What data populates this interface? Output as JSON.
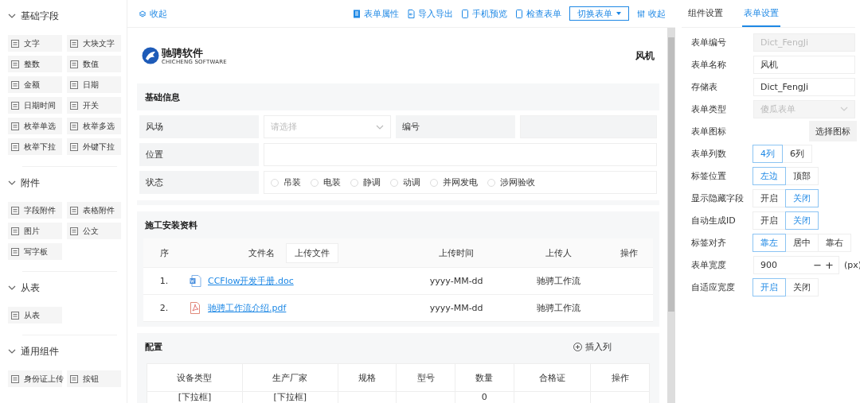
{
  "sidebar": {
    "groups": [
      {
        "title": "基础字段",
        "expanded": true,
        "items": [
          {
            "label": "文字"
          },
          {
            "label": "大块文字"
          },
          {
            "label": "整数"
          },
          {
            "label": "数值"
          },
          {
            "label": "金额"
          },
          {
            "label": "日期"
          },
          {
            "label": "日期时间"
          },
          {
            "label": "开关"
          },
          {
            "label": "枚举单选"
          },
          {
            "label": "枚举多选"
          },
          {
            "label": "枚举下拉"
          },
          {
            "label": "外键下拉"
          }
        ]
      },
      {
        "title": "附件",
        "expanded": true,
        "items": [
          {
            "label": "字段附件"
          },
          {
            "label": "表格附件"
          },
          {
            "label": "图片"
          },
          {
            "label": "公文"
          },
          {
            "label": "写字板"
          }
        ]
      },
      {
        "title": "从表",
        "expanded": true,
        "items": [
          {
            "label": "从表"
          }
        ]
      },
      {
        "title": "通用组件",
        "expanded": true,
        "items": [
          {
            "label": "身份证上传"
          },
          {
            "label": "按钮"
          }
        ]
      }
    ]
  },
  "toolbar": {
    "collapse": "收起",
    "actions": [
      {
        "label": "表单属性"
      },
      {
        "label": "导入导出"
      },
      {
        "label": "手机预览"
      },
      {
        "label": "检查表单"
      }
    ],
    "switch_button": "切换表单",
    "collapse_right": "收起"
  },
  "form": {
    "logo": {
      "name": "驰骋软件",
      "subtitle": "CHICHENG SOFTWARE"
    },
    "title": "风机",
    "basic": {
      "title": "基础信息",
      "fields": [
        {
          "label": "风场",
          "kind": "select",
          "placeholder": "请选择"
        },
        {
          "label": "编号",
          "kind": "readonly"
        },
        {
          "label": "位置",
          "kind": "input"
        },
        {
          "label": "状态",
          "kind": "radios",
          "options": [
            {
              "label": "吊装",
              "selected": false
            },
            {
              "label": "电装",
              "selected": false
            },
            {
              "label": "静调",
              "selected": false
            },
            {
              "label": "动调",
              "selected": false
            },
            {
              "label": "并网发电",
              "selected": false
            },
            {
              "label": "涉网验收",
              "selected": false
            }
          ]
        }
      ]
    },
    "attachments": {
      "title": "施工安装资料",
      "upload_button": "上传文件",
      "columns": [
        "序",
        "文件名",
        "上传时间",
        "上传人",
        "操作"
      ],
      "rows": [
        {
          "index": "1.",
          "file": "CCFlow开发手册.doc",
          "kind": "doc",
          "time": "yyyy-MM-dd",
          "uploader": "驰骋工作流"
        },
        {
          "index": "2.",
          "file": "驰骋工作流介绍.pdf",
          "kind": "pdf",
          "time": "yyyy-MM-dd",
          "uploader": "驰骋工作流"
        }
      ]
    },
    "config": {
      "title": "配置",
      "insert_button": "插入列",
      "columns": [
        "设备类型",
        "生产厂家",
        "规格",
        "型号",
        "数量",
        "合格证",
        "操作"
      ],
      "rows": [
        [
          "[下拉框]",
          "[下拉框]",
          null,
          null,
          "0",
          null,
          null
        ]
      ]
    }
  },
  "settings": {
    "tabs": [
      {
        "label": "组件设置",
        "selected": false
      },
      {
        "label": "表单设置",
        "selected": true
      }
    ],
    "fields": [
      {
        "label": "表单编号",
        "kind": "input",
        "value": "Dict_FengJi",
        "disabled": true
      },
      {
        "label": "表单名称",
        "kind": "input",
        "value": "风机",
        "disabled": false
      },
      {
        "label": "存储表",
        "kind": "input",
        "value": "Dict_FengJi",
        "disabled": false
      },
      {
        "label": "表单类型",
        "kind": "select",
        "value": "傻瓜表单",
        "disabled": true
      },
      {
        "label": "表单图标",
        "kind": "icon_picker",
        "button": "选择图标"
      },
      {
        "label": "表单列数",
        "kind": "segmented",
        "options": [
          {
            "label": "4列",
            "selected": true
          },
          {
            "label": "6列",
            "selected": false
          }
        ]
      },
      {
        "label": "标签位置",
        "kind": "segmented",
        "options": [
          {
            "label": "左边",
            "selected": true
          },
          {
            "label": "顶部",
            "selected": false
          }
        ]
      },
      {
        "label": "显示隐藏字段",
        "kind": "segmented",
        "options": [
          {
            "label": "开启",
            "selected": false
          },
          {
            "label": "关闭",
            "selected": true
          }
        ]
      },
      {
        "label": "自动生成ID",
        "kind": "segmented",
        "options": [
          {
            "label": "开启",
            "selected": false
          },
          {
            "label": "关闭",
            "selected": true
          }
        ]
      },
      {
        "label": "标签对齐",
        "kind": "segmented",
        "options": [
          {
            "label": "靠左",
            "selected": true
          },
          {
            "label": "居中",
            "selected": false
          },
          {
            "label": "靠右",
            "selected": false
          }
        ]
      },
      {
        "label": "表单宽度",
        "kind": "number",
        "value": "900",
        "minus": "−",
        "plus": "+",
        "unit": "(px)"
      },
      {
        "label": "自适应宽度",
        "kind": "segmented",
        "options": [
          {
            "label": "开启",
            "selected": true
          },
          {
            "label": "关闭",
            "selected": false
          }
        ]
      }
    ]
  }
}
